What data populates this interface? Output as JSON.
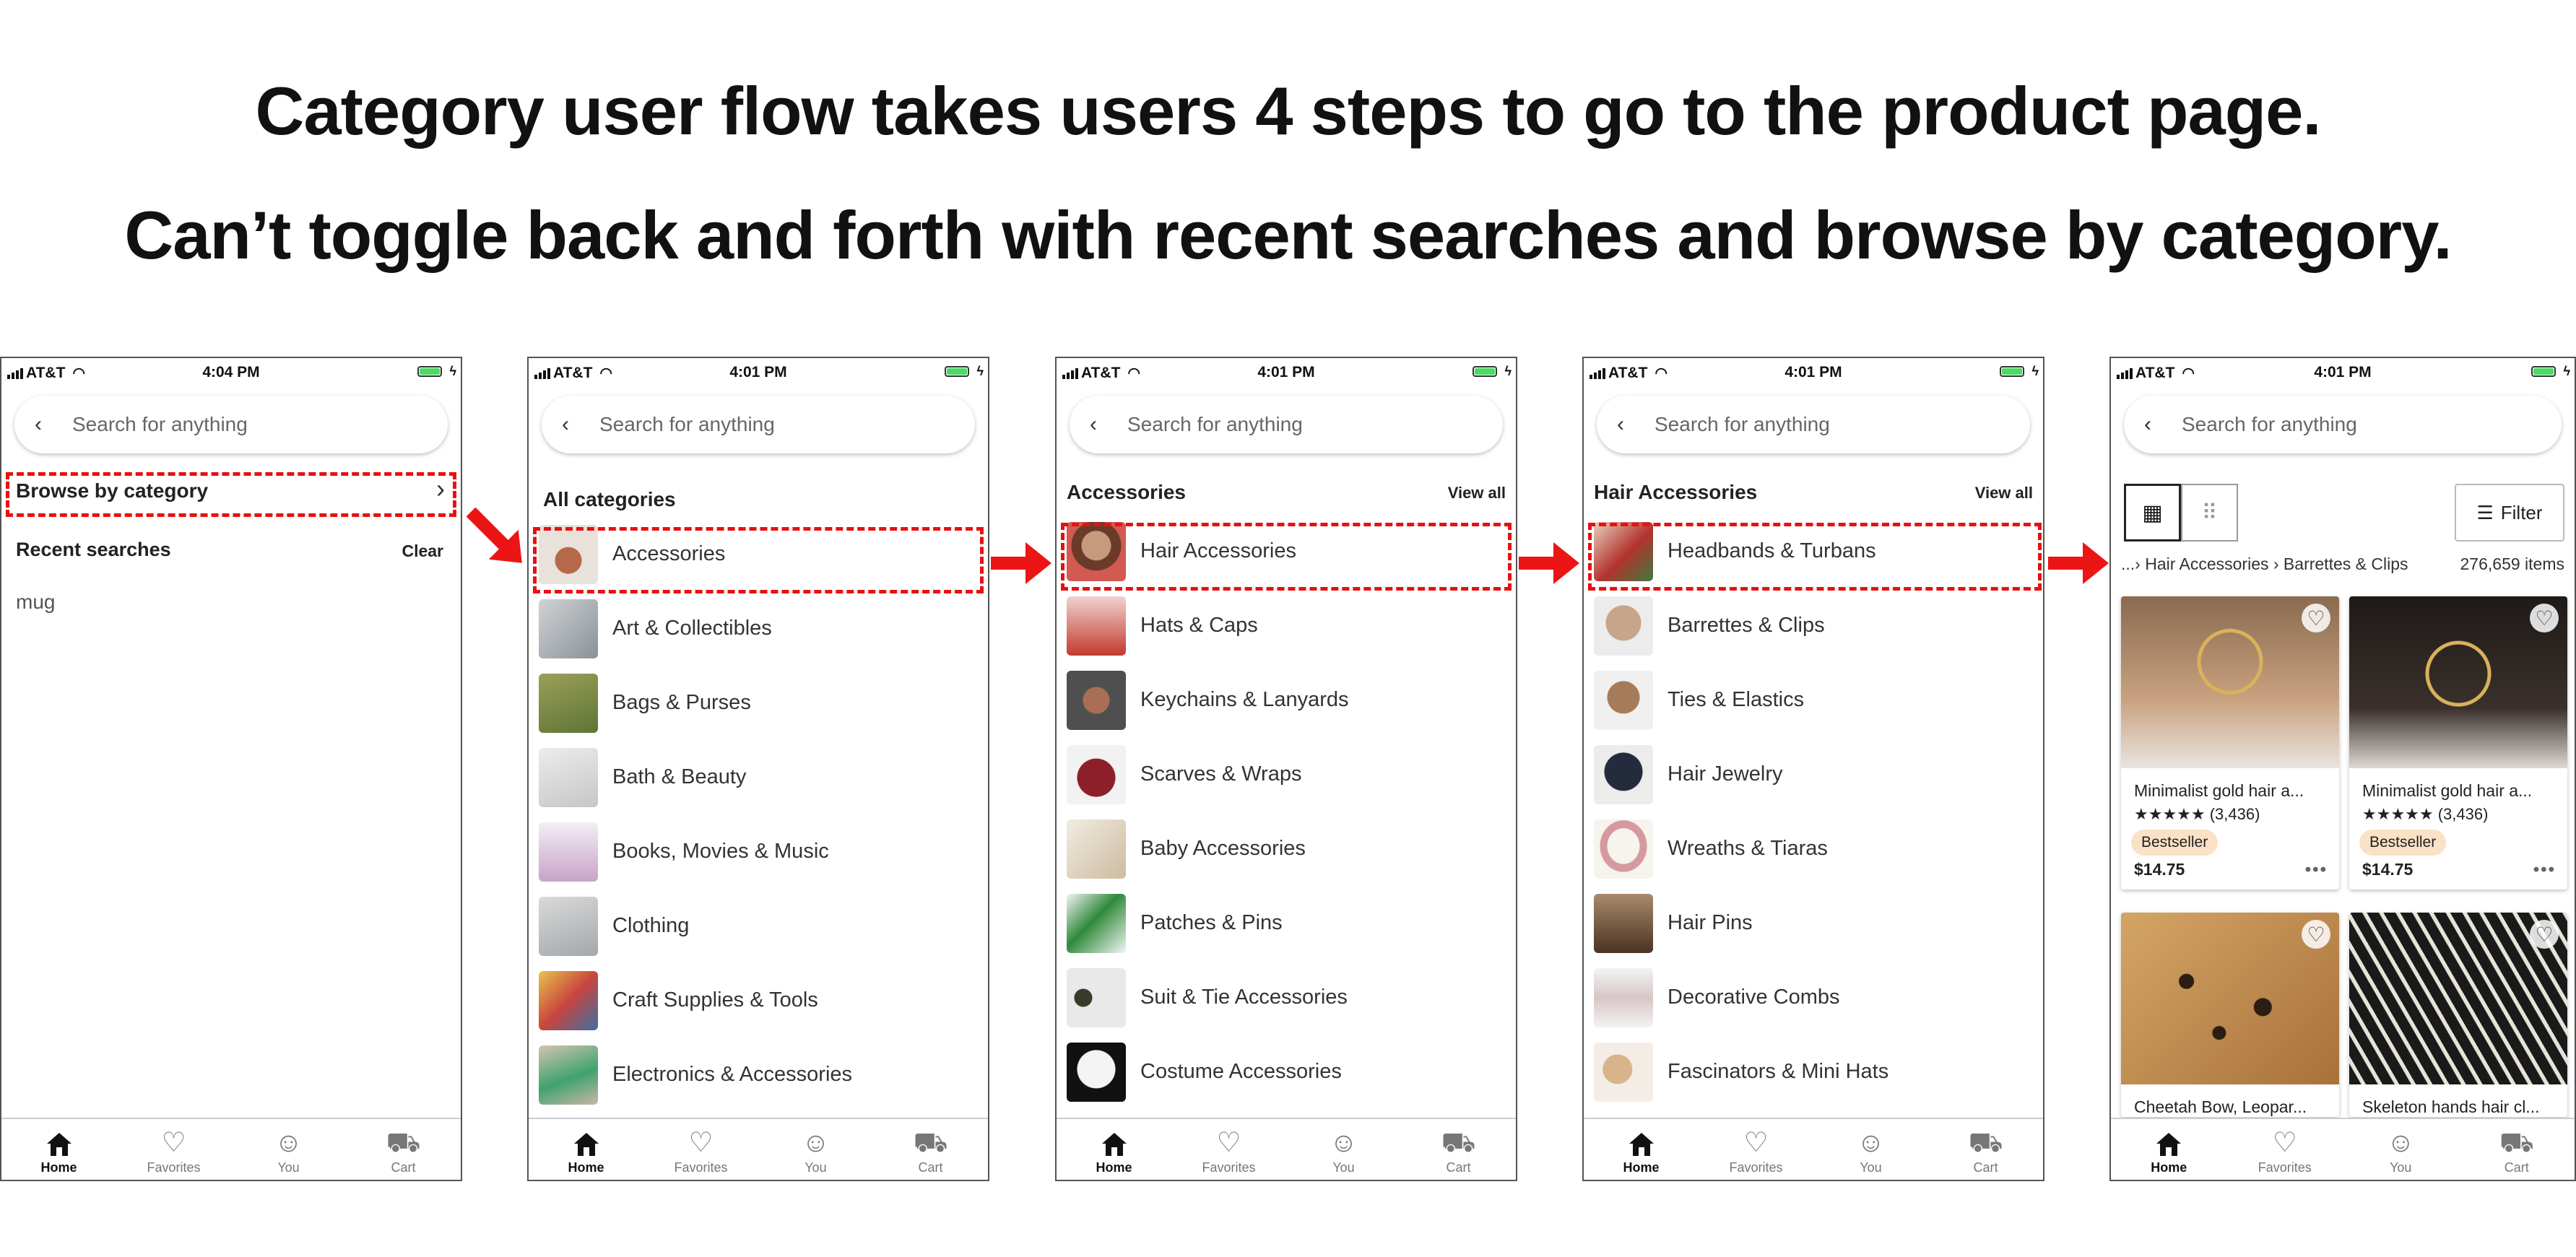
{
  "headline_1": "Category user flow takes users 4 steps to go to the product page.",
  "headline_2": "Can’t toggle back and forth with recent searches and browse by category.",
  "status": {
    "carrier": "AT&T",
    "time_s1": "4:04 PM",
    "time_s2": "4:01 PM",
    "time_s3": "4:01 PM",
    "time_s4": "4:01 PM",
    "time_s5": "4:01 PM"
  },
  "search_placeholder": "Search for anything",
  "tabs": {
    "home": "Home",
    "favorites": "Favorites",
    "you": "You",
    "cart": "Cart"
  },
  "screen1": {
    "browse": "Browse by category",
    "recent_title": "Recent searches",
    "clear": "Clear",
    "recent_items": [
      "mug"
    ]
  },
  "screen2": {
    "title": "All categories",
    "items": [
      "Accessories",
      "Art & Collectibles",
      "Bags & Purses",
      "Bath & Beauty",
      "Books, Movies & Music",
      "Clothing",
      "Craft Supplies & Tools",
      "Electronics & Accessories"
    ]
  },
  "screen3": {
    "title": "Accessories",
    "view_all": "View all",
    "items": [
      "Hair Accessories",
      "Hats & Caps",
      "Keychains & Lanyards",
      "Scarves & Wraps",
      "Baby Accessories",
      "Patches & Pins",
      "Suit & Tie Accessories",
      "Costume Accessories"
    ]
  },
  "screen4": {
    "title": "Hair Accessories",
    "view_all": "View all",
    "items": [
      "Headbands & Turbans",
      "Barrettes & Clips",
      "Ties & Elastics",
      "Hair Jewelry",
      "Wreaths & Tiaras",
      "Hair Pins",
      "Decorative Combs",
      "Fascinators & Mini Hats"
    ]
  },
  "screen5": {
    "filter": "Filter",
    "breadcrumb": "...› Hair Accessories › Barrettes & Clips",
    "count": "276,659 items",
    "products": [
      {
        "title": "Minimalist gold hair a...",
        "rating": "★★★★★ (3,436)",
        "badge": "Bestseller",
        "price": "$14.75"
      },
      {
        "title": "Minimalist gold hair a...",
        "rating": "★★★★★ (3,436)",
        "badge": "Bestseller",
        "price": "$14.75"
      },
      {
        "title": "Cheetah Bow, Leopar...",
        "rating": "",
        "badge": "",
        "price": ""
      },
      {
        "title": "Skeleton hands hair cl...",
        "rating": "",
        "badge": "",
        "price": ""
      }
    ]
  },
  "colors": {
    "highlight": "#e81010",
    "arrow": "#ec1515",
    "battery": "#4cd964",
    "badge": "#fbe1c6"
  },
  "icons": [
    "back-chevron-icon",
    "home-icon",
    "heart-icon",
    "person-icon",
    "cart-icon",
    "grid-icon",
    "filter-icon",
    "wifi-icon",
    "battery-icon"
  ]
}
